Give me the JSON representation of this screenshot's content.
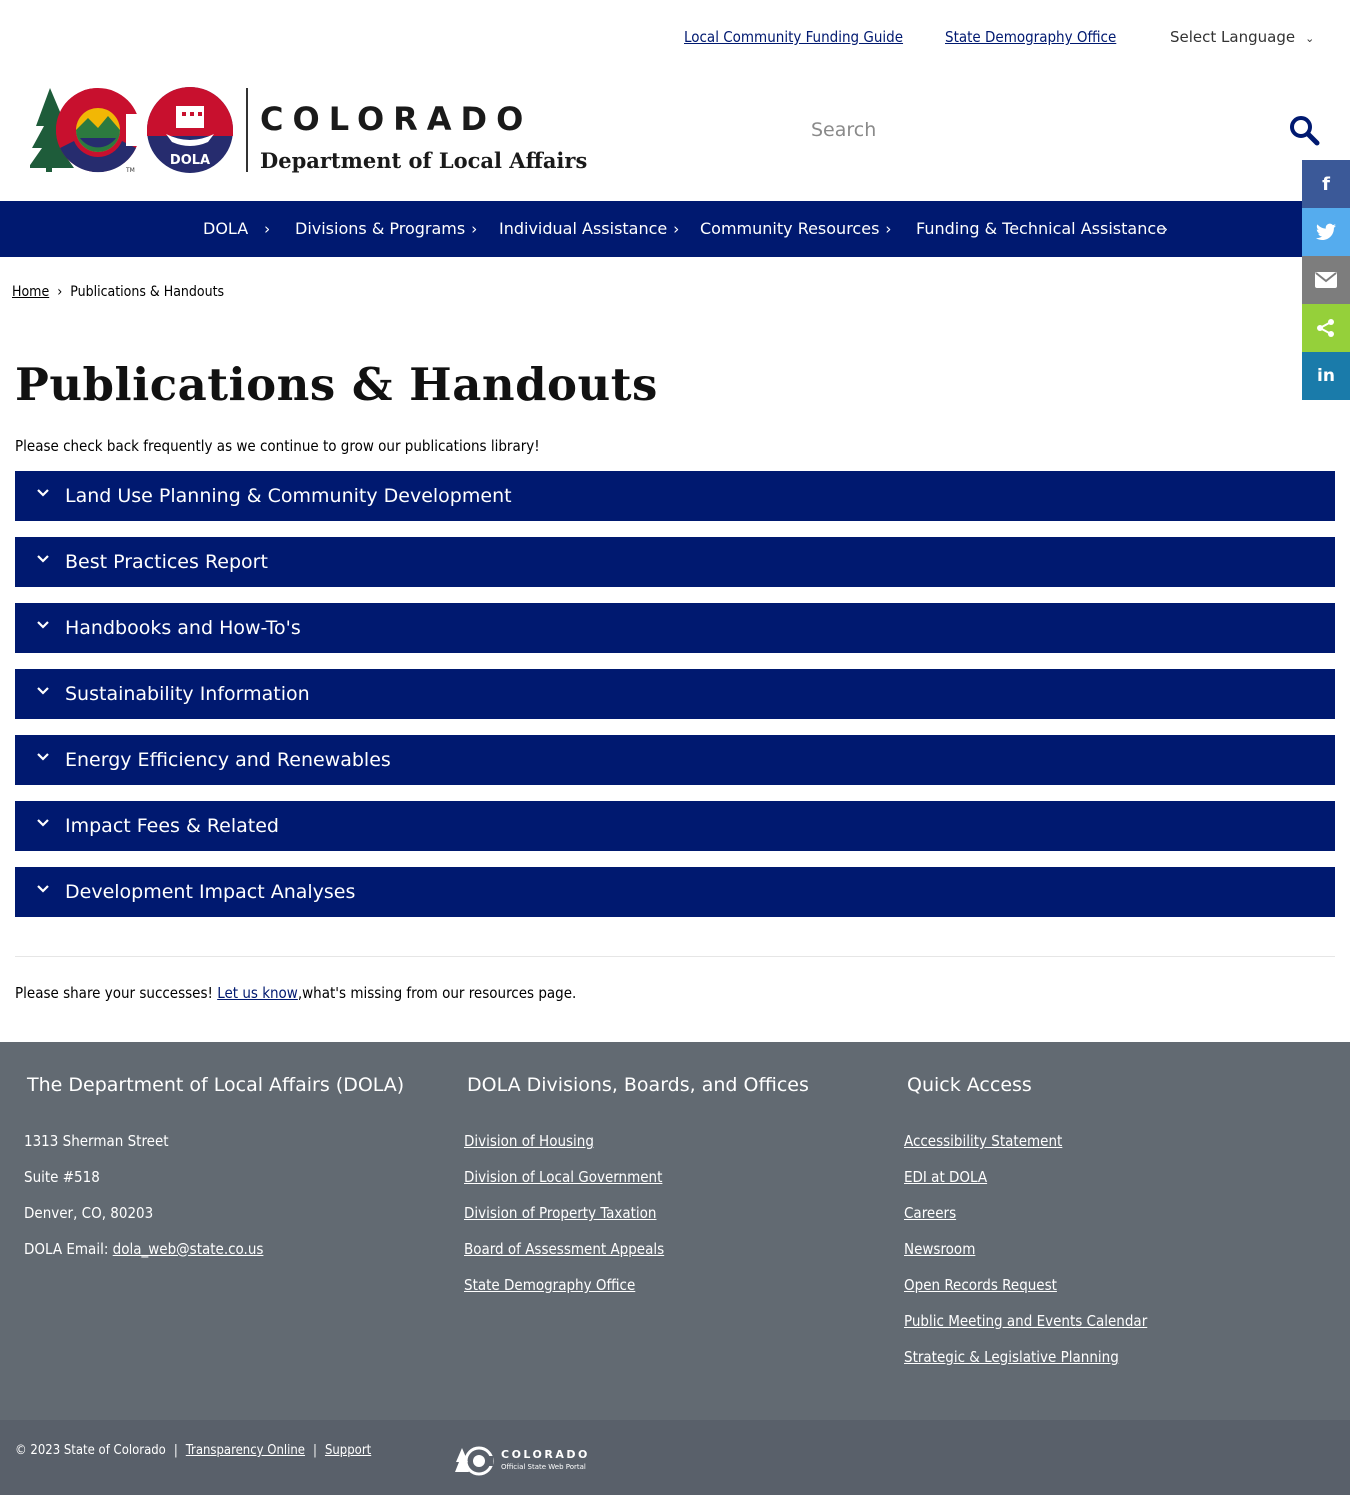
{
  "utility": {
    "links": [
      "Local Community Funding Guide",
      "State Demography Office"
    ],
    "language_label": "Select Language"
  },
  "brand": {
    "state_name": "COLORADO",
    "department": "Department of Local Affairs",
    "badge": "DOLA",
    "colors": {
      "navy": "#001970",
      "red": "#c8102e",
      "gold": "#f2b705",
      "green": "#1e5c3a"
    }
  },
  "search": {
    "placeholder": "Search"
  },
  "nav": {
    "items": [
      "DOLA",
      "Divisions & Programs",
      "Individual Assistance",
      "Community Resources",
      "Funding & Technical Assistance"
    ]
  },
  "share": {
    "buttons": [
      {
        "name": "facebook",
        "glyph": "f",
        "color": "#3b5998"
      },
      {
        "name": "twitter",
        "glyph": "t",
        "color": "#55acee"
      },
      {
        "name": "email",
        "glyph": "✉",
        "color": "#7d7d7d"
      },
      {
        "name": "share",
        "glyph": "<",
        "color": "#95d03a"
      },
      {
        "name": "linkedin",
        "glyph": "in",
        "color": "#1a7baa"
      }
    ]
  },
  "breadcrumb": {
    "home": "Home",
    "current": "Publications & Handouts"
  },
  "page": {
    "title": "Publications & Handouts",
    "intro": "Please check back frequently as we continue to grow our publications library!"
  },
  "accordion": [
    "Land Use Planning & Community Development",
    "Best Practices Report",
    "Handbooks and How-To's",
    "Sustainability Information",
    "Energy Efficiency and Renewables",
    "Impact Fees & Related",
    "Development Impact Analyses"
  ],
  "feedback": {
    "before": "Please share your successes! ",
    "link": "Let us know",
    "after": ",what's missing from our resources page."
  },
  "footer": {
    "col1": {
      "title": "The Department of Local Affairs (DOLA)",
      "address1": "1313 Sherman Street",
      "address2": "Suite  #518",
      "address3": "Denver, CO, 80203",
      "email_label": "DOLA Email: ",
      "email": "dola_web@state.co.us"
    },
    "col2": {
      "title": "DOLA Divisions, Boards, and Offices",
      "links": [
        "Division of Housing",
        "Division of Local Government",
        "Division of Property Taxation",
        "Board of Assessment Appeals",
        "State Demography Office"
      ]
    },
    "col3": {
      "title": "Quick Access",
      "links": [
        "Accessibility Statement",
        "EDI at DOLA",
        "Careers",
        "Newsroom",
        "Open Records Request",
        "Public Meeting and Events Calendar",
        "Strategic & Legislative Planning"
      ]
    }
  },
  "bottom": {
    "copyright": "© 2023 State of Colorado",
    "links": [
      "Transparency Online",
      "Support"
    ],
    "portal_title": "COLORADO",
    "portal_sub": "Official State Web Portal"
  }
}
